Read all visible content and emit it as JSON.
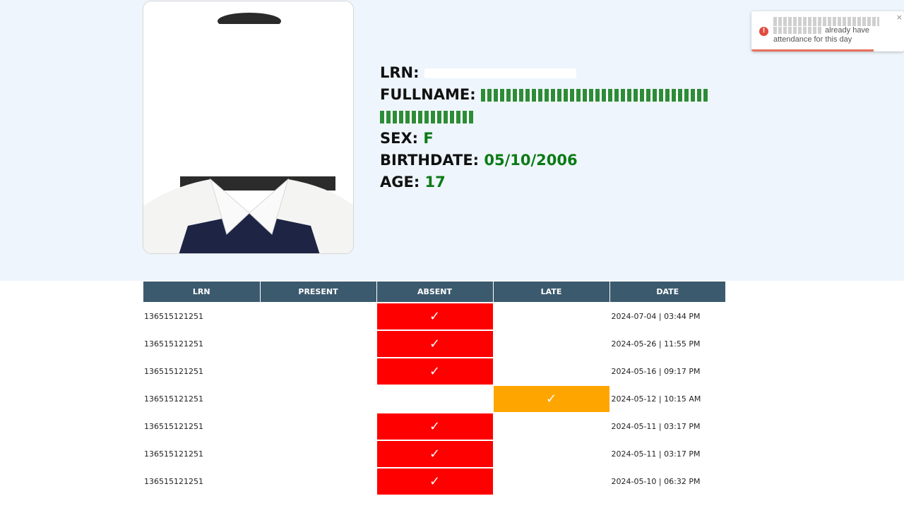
{
  "profile": {
    "lrn_label": "LRN:",
    "fullname_label": "FULLNAME:",
    "sex_label": "SEX:",
    "sex_value": "F",
    "birthdate_label": "BIRTHDATE:",
    "birthdate_value": "05/10/2006",
    "age_label": "AGE:",
    "age_value": "17"
  },
  "table": {
    "headers": [
      "LRN",
      "PRESENT",
      "ABSENT",
      "LATE",
      "DATE"
    ],
    "rows": [
      {
        "lrn": "136515121251",
        "status": "absent",
        "date": "2024-07-04 | 03:44 PM"
      },
      {
        "lrn": "136515121251",
        "status": "absent",
        "date": "2024-05-26 | 11:55 PM"
      },
      {
        "lrn": "136515121251",
        "status": "absent",
        "date": "2024-05-16 | 09:17 PM"
      },
      {
        "lrn": "136515121251",
        "status": "late",
        "date": "2024-05-12 | 10:15 AM"
      },
      {
        "lrn": "136515121251",
        "status": "absent",
        "date": "2024-05-11 | 03:17 PM"
      },
      {
        "lrn": "136515121251",
        "status": "absent",
        "date": "2024-05-11 | 03:17 PM"
      },
      {
        "lrn": "136515121251",
        "status": "absent",
        "date": "2024-05-10 | 06:32 PM"
      }
    ],
    "check_glyph": "✓"
  },
  "toast": {
    "message": "already have attendance for this day",
    "close_glyph": "×",
    "icon_glyph": "!",
    "progress": 0.8
  },
  "colors": {
    "absent": "#ff0000",
    "late": "#ffa500",
    "header": "#3c5a6e",
    "value_green": "#0b7a16"
  }
}
